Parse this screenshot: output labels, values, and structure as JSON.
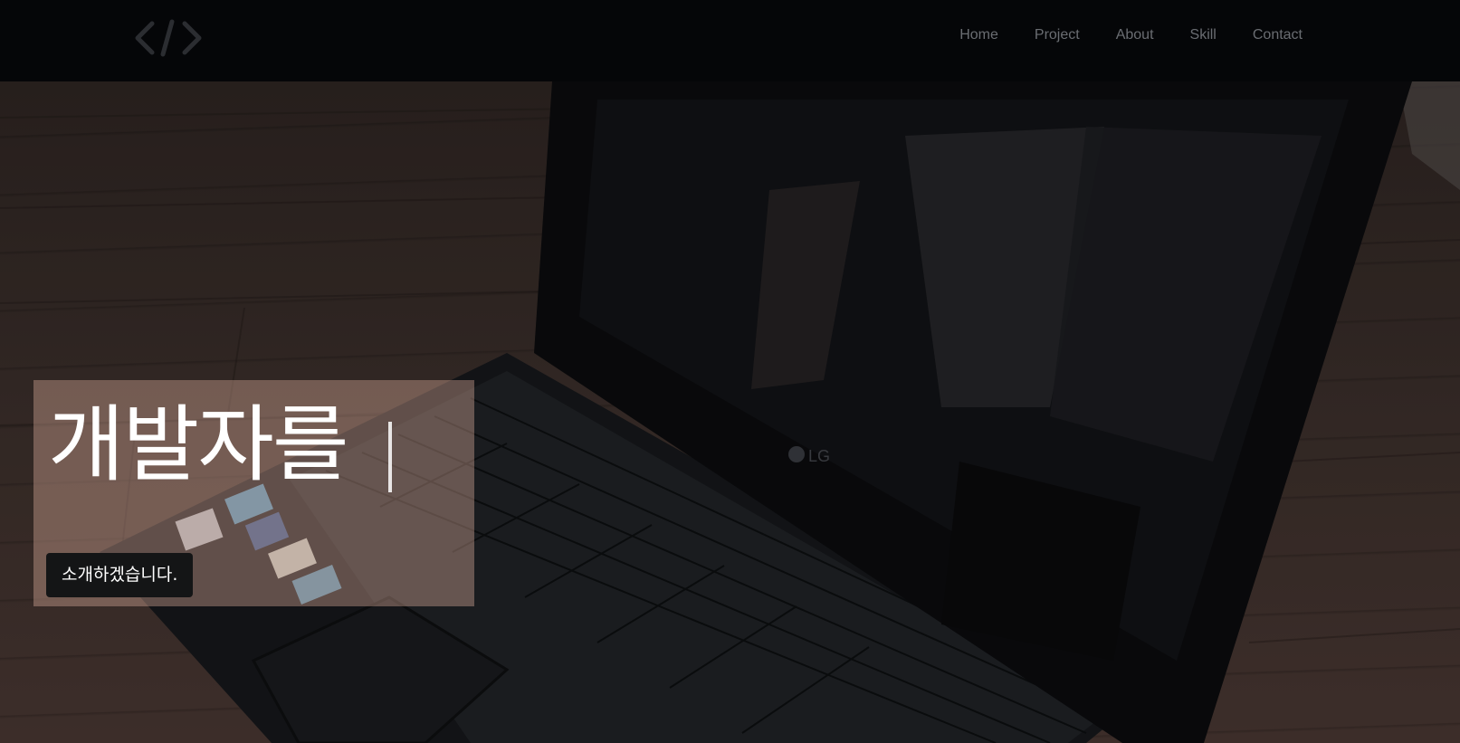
{
  "nav": {
    "logo_icon": "code-brackets-icon",
    "items": [
      {
        "label": "Home"
      },
      {
        "label": "Project"
      },
      {
        "label": "About"
      },
      {
        "label": "Skill"
      },
      {
        "label": "Contact"
      }
    ]
  },
  "hero": {
    "headline": "개발자를",
    "subtitle": "소개하겠습니다.",
    "background_image": "laptop-on-wooden-floor",
    "colors": {
      "nav_bg": "#050608",
      "nav_link": "#6a6d72",
      "chip_bg": "#141516",
      "text": "#ffffff"
    }
  }
}
